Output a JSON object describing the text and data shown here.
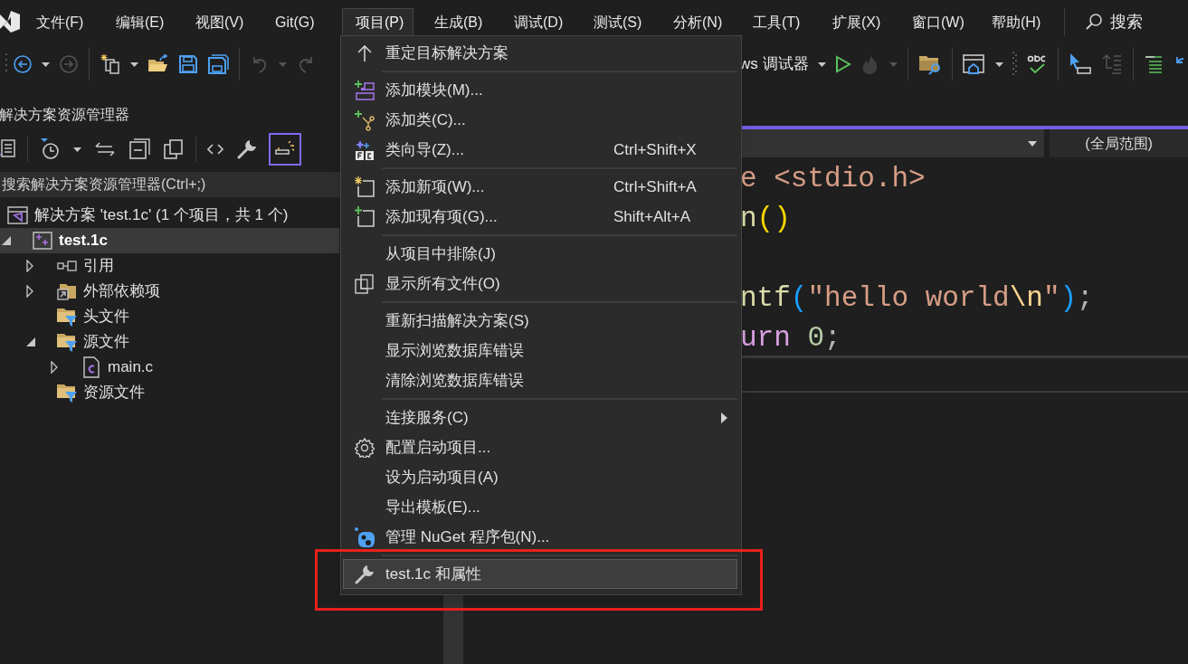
{
  "menu_bar": {
    "items": [
      {
        "label": "文件(F)",
        "selected": false
      },
      {
        "label": "编辑(E)",
        "selected": false
      },
      {
        "label": "视图(V)",
        "selected": false
      },
      {
        "label": "Git(G)",
        "selected": false
      },
      {
        "label": "项目(P)",
        "selected": true
      },
      {
        "label": "生成(B)",
        "selected": false
      },
      {
        "label": "调试(D)",
        "selected": false
      },
      {
        "label": "测试(S)",
        "selected": false
      },
      {
        "label": "分析(N)",
        "selected": false
      },
      {
        "label": "工具(T)",
        "selected": false
      },
      {
        "label": "扩展(X)",
        "selected": false
      },
      {
        "label": "窗口(W)",
        "selected": false
      },
      {
        "label": "帮助(H)",
        "selected": false
      }
    ],
    "search": {
      "label": "搜索"
    }
  },
  "toolbar": {
    "left_buttons": [
      {
        "kind": "back",
        "disabled": false
      },
      {
        "kind": "caret",
        "disabled": false
      },
      {
        "kind": "forward",
        "disabled": true
      },
      {
        "kind": "separator"
      },
      {
        "kind": "new-project",
        "disabled": false
      },
      {
        "kind": "caret",
        "disabled": false
      },
      {
        "kind": "open",
        "disabled": false
      },
      {
        "kind": "save",
        "disabled": false
      },
      {
        "kind": "save-all",
        "disabled": false
      },
      {
        "kind": "separator"
      },
      {
        "kind": "undo",
        "disabled": true
      },
      {
        "kind": "caret",
        "disabled": true
      },
      {
        "kind": "redo",
        "disabled": true
      }
    ],
    "right_buttons": [
      {
        "kind": "target",
        "label": "ws 调试器",
        "disabled": false
      },
      {
        "kind": "caret",
        "disabled": false
      },
      {
        "kind": "play",
        "disabled": false
      },
      {
        "kind": "hot-reload",
        "disabled": true
      },
      {
        "kind": "caret",
        "disabled": true
      },
      {
        "kind": "separator"
      },
      {
        "kind": "folder-search",
        "disabled": false
      },
      {
        "kind": "separator"
      },
      {
        "kind": "window-home",
        "disabled": false
      },
      {
        "kind": "caret",
        "disabled": false
      },
      {
        "kind": "grip",
        "disabled": false
      },
      {
        "kind": "spell-check",
        "disabled": false
      },
      {
        "kind": "separator"
      },
      {
        "kind": "pointer",
        "disabled": false
      },
      {
        "kind": "indent",
        "disabled": true
      },
      {
        "kind": "separator"
      },
      {
        "kind": "lines",
        "disabled": false
      },
      {
        "kind": "undo-blue",
        "disabled": false
      }
    ]
  },
  "solution_explorer": {
    "title": "解决方案资源管理器",
    "toolbar": [
      {
        "kind": "vs-page",
        "selected": false
      },
      {
        "kind": "separator"
      },
      {
        "kind": "history",
        "selected": false
      },
      {
        "kind": "caret",
        "selected": false
      },
      {
        "kind": "sync",
        "selected": false
      },
      {
        "kind": "collapse",
        "selected": false
      },
      {
        "kind": "show-all",
        "selected": false
      },
      {
        "kind": "separator"
      },
      {
        "kind": "code",
        "selected": false
      },
      {
        "kind": "wrench",
        "selected": false
      },
      {
        "kind": "preview",
        "selected": true
      }
    ],
    "search": {
      "placeholder": "搜索解决方案资源管理器(Ctrl+;)"
    },
    "tree": [
      {
        "label": "解决方案 'test.1c' (1 个项目，共 1 个)",
        "kind": "solution",
        "selected": false,
        "children": [
          {
            "label": "test.1c",
            "kind": "project",
            "selected": true,
            "expanded": true,
            "children": [
              {
                "label": "引用",
                "kind": "references",
                "selected": false,
                "expanded": false
              },
              {
                "label": "外部依赖项",
                "kind": "external",
                "selected": false,
                "expanded": false
              },
              {
                "label": "头文件",
                "kind": "filter",
                "selected": false
              },
              {
                "label": "源文件",
                "kind": "filter",
                "selected": false,
                "expanded": true,
                "children": [
                  {
                    "label": "main.c",
                    "kind": "c-file",
                    "selected": false,
                    "expanded": false
                  }
                ]
              },
              {
                "label": "资源文件",
                "kind": "filter",
                "selected": false
              }
            ]
          }
        ]
      }
    ]
  },
  "editor": {
    "scope": "(全局范围)",
    "code_lines": [
      {
        "kind": "code",
        "tokens": [
          {
            "text": "e",
            "kind": "directive"
          },
          {
            "text": " <stdio.h>",
            "kind": "string"
          }
        ]
      },
      {
        "kind": "code",
        "tokens": [
          {
            "text": "n",
            "kind": "function"
          },
          {
            "text": "()",
            "kind": "bracket1"
          }
        ]
      },
      {
        "kind": "blank"
      },
      {
        "kind": "code",
        "tokens": [
          {
            "text": "ntf",
            "kind": "function"
          },
          {
            "text": "(",
            "kind": "bracket2"
          },
          {
            "text": "\"hello world",
            "kind": "string"
          },
          {
            "text": "\\n",
            "kind": "escape"
          },
          {
            "text": "\"",
            "kind": "string"
          },
          {
            "text": ")",
            "kind": "bracket2"
          },
          {
            "text": ";",
            "kind": "punct"
          }
        ]
      },
      {
        "kind": "code",
        "tokens": [
          {
            "text": "urn",
            "kind": "keyword"
          },
          {
            "text": " 0",
            "kind": "number"
          },
          {
            "text": ";",
            "kind": "punct"
          }
        ]
      }
    ]
  },
  "project_menu": {
    "items": [
      {
        "kind": "item",
        "label": "重定目标解决方案",
        "selected": false,
        "submenu": false,
        "outlined": false
      },
      {
        "kind": "separator"
      },
      {
        "kind": "item",
        "label": "添加模块(M)...",
        "selected": false,
        "submenu": false,
        "outlined": false
      },
      {
        "kind": "item",
        "label": "添加类(C)...",
        "selected": false,
        "submenu": false,
        "outlined": false
      },
      {
        "kind": "item",
        "label": "类向导(Z)...",
        "shortcut": "Ctrl+Shift+X",
        "selected": false,
        "submenu": false,
        "outlined": false
      },
      {
        "kind": "separator"
      },
      {
        "kind": "item",
        "label": "添加新项(W)...",
        "shortcut": "Ctrl+Shift+A",
        "selected": false,
        "submenu": false,
        "outlined": false
      },
      {
        "kind": "item",
        "label": "添加现有项(G)...",
        "shortcut": "Shift+Alt+A",
        "selected": false,
        "submenu": false,
        "outlined": false
      },
      {
        "kind": "separator"
      },
      {
        "kind": "item",
        "label": "从项目中排除(J)",
        "selected": false,
        "submenu": false,
        "outlined": false
      },
      {
        "kind": "item",
        "label": "显示所有文件(O)",
        "selected": false,
        "submenu": false,
        "outlined": false
      },
      {
        "kind": "separator"
      },
      {
        "kind": "item",
        "label": "重新扫描解决方案(S)",
        "selected": false,
        "submenu": false,
        "outlined": false
      },
      {
        "kind": "item",
        "label": "显示浏览数据库错误",
        "selected": false,
        "submenu": false,
        "outlined": false
      },
      {
        "kind": "item",
        "label": "清除浏览数据库错误",
        "selected": false,
        "submenu": false,
        "outlined": false
      },
      {
        "kind": "separator"
      },
      {
        "kind": "item",
        "label": "连接服务(C)",
        "selected": false,
        "submenu": true,
        "outlined": false
      },
      {
        "kind": "item",
        "label": "配置启动项目...",
        "selected": false,
        "submenu": false,
        "outlined": false
      },
      {
        "kind": "item",
        "label": "设为启动项目(A)",
        "selected": false,
        "submenu": false,
        "outlined": false
      },
      {
        "kind": "item",
        "label": "导出模板(E)...",
        "selected": false,
        "submenu": false,
        "outlined": false
      },
      {
        "kind": "item",
        "label": "管理 NuGet 程序包(N)...",
        "selected": false,
        "submenu": false,
        "outlined": false
      },
      {
        "kind": "separator"
      },
      {
        "kind": "item",
        "label": "test.1c 和属性",
        "selected": true,
        "submenu": false,
        "outlined": true
      }
    ]
  }
}
